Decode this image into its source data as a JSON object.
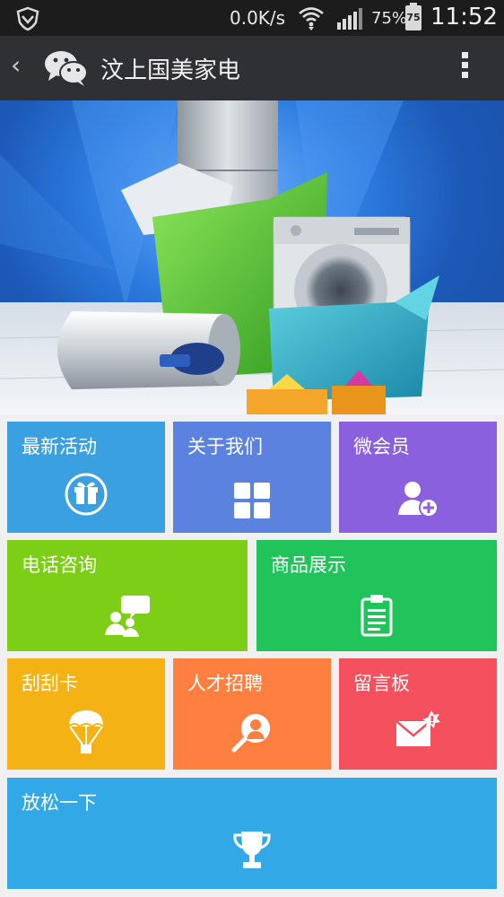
{
  "status_bar": {
    "network_speed": "0.0K/s",
    "battery_percent": "75%",
    "battery_level": "75",
    "time": "11:52"
  },
  "nav": {
    "title": "汶上国美家电",
    "icons": [
      "back-chevron-icon",
      "wechat-icon",
      "more-menu-icon"
    ]
  },
  "banner": {
    "slide_count": 3,
    "active_slide": 1
  },
  "tiles": [
    {
      "label": "最新活动",
      "color": "#3aa0e0",
      "icon": "gift-icon"
    },
    {
      "label": "关于我们",
      "color": "#5a82de",
      "icon": "grid-icon"
    },
    {
      "label": "微会员",
      "color": "#8a60de",
      "icon": "add-user-icon"
    },
    {
      "label": "电话咨询",
      "color": "#7ccf16",
      "icon": "chat-people-icon"
    },
    {
      "label": "商品展示",
      "color": "#20c45a",
      "icon": "clipboard-icon"
    },
    {
      "label": "刮刮卡",
      "color": "#f4b214",
      "icon": "parachute-icon"
    },
    {
      "label": "人才招聘",
      "color": "#fe7f3f",
      "icon": "search-person-icon"
    },
    {
      "label": "留言板",
      "color": "#f5505e",
      "icon": "mail-alert-icon"
    },
    {
      "label": "放松一下",
      "color": "#32a8e6",
      "icon": "trophy-icon"
    }
  ]
}
